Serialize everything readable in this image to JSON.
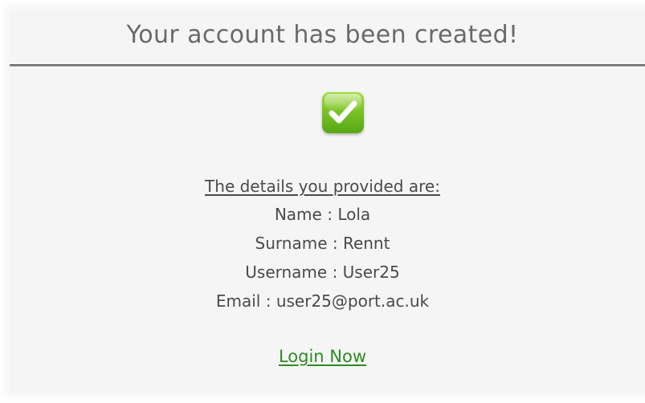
{
  "header": {
    "title": "Your account has been created!"
  },
  "status_icon": "checkmark-success-icon",
  "details": {
    "heading": "The details you provided are:",
    "name": {
      "label": "Name",
      "separator": " : ",
      "value": "Lola"
    },
    "surname": {
      "label": "Surname",
      "separator": " : ",
      "value": "Rennt"
    },
    "username": {
      "label": "Username",
      "separator": " : ",
      "value": "User25"
    },
    "email": {
      "label": "Email",
      "separator": " : ",
      "value": "user25@port.ac.uk"
    }
  },
  "actions": {
    "login_label": "Login Now"
  },
  "colors": {
    "icon_green": "#7cc427",
    "link_green": "#2e8b22",
    "text_gray": "#4a4a4a",
    "title_gray": "#6a6a6a"
  }
}
